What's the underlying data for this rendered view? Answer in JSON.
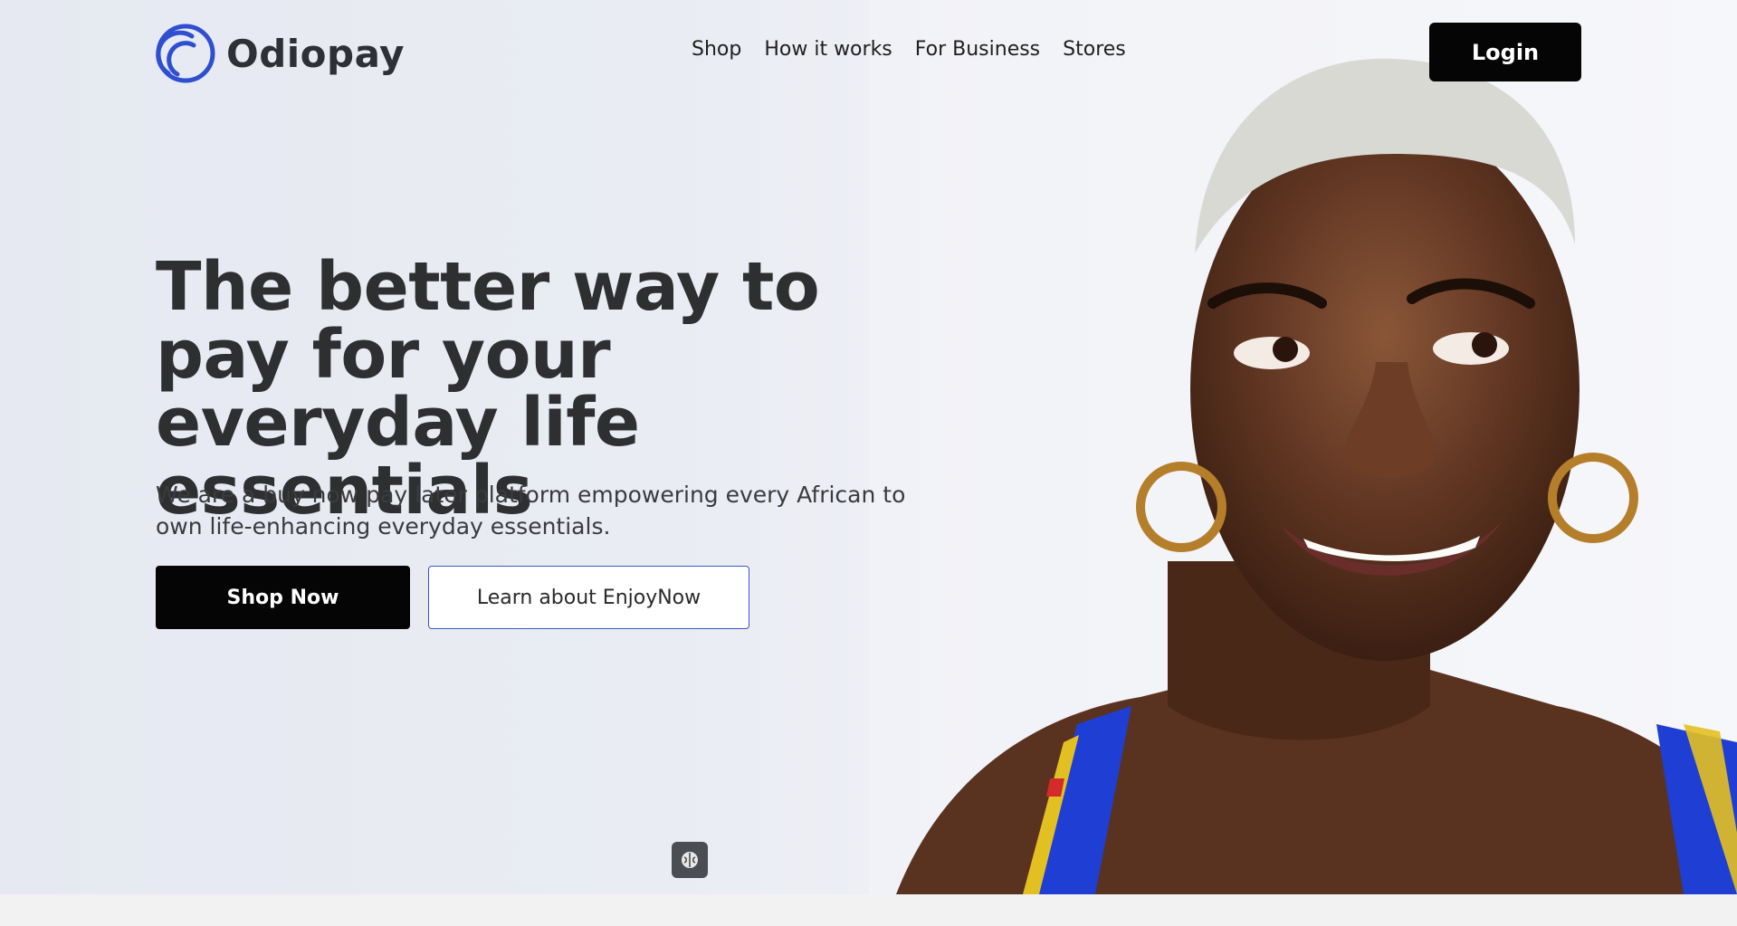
{
  "brand": {
    "name": "Odiopay",
    "logo_icon": "odiopay-ring-logo",
    "accent": "#2f4fd0"
  },
  "nav": {
    "links": [
      "Shop",
      "How it works",
      "For Business",
      "Stores"
    ],
    "login_label": "Login"
  },
  "hero": {
    "headline": "The better way to pay for your everyday life essentials",
    "subtitle": "We are a buy now pay later platform empowering every African to own life-enhancing everyday essentials.",
    "primary_cta": "Shop Now",
    "secondary_cta": "Learn about EnjoyNow",
    "image": "smiling-woman-portrait"
  },
  "widget": {
    "icon": "brain-icon"
  },
  "colors": {
    "primary_button": "#050505",
    "text": "#2e2f31",
    "outline": "#3957c9"
  }
}
